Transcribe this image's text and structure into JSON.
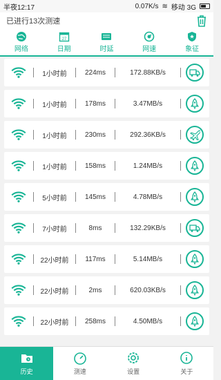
{
  "status": {
    "time": "半夜12:17",
    "speed": "0.07K/s",
    "carrier": "移动 3G"
  },
  "header": {
    "title": "已进行13次测速"
  },
  "tabs": [
    {
      "label": "网络",
      "icon": "globe-icon"
    },
    {
      "label": "日期",
      "icon": "calendar-icon"
    },
    {
      "label": "时延",
      "icon": "ping-icon"
    },
    {
      "label": "网速",
      "icon": "speedometer-icon"
    },
    {
      "label": "象征",
      "icon": "badge-icon"
    }
  ],
  "rows": [
    {
      "time": "1小时前",
      "ping": "224ms",
      "speed": "172.88KB/s",
      "icon": "truck-icon"
    },
    {
      "time": "1小时前",
      "ping": "178ms",
      "speed": "3.47MB/s",
      "icon": "rocket-icon"
    },
    {
      "time": "1小时前",
      "ping": "230ms",
      "speed": "292.36KB/s",
      "icon": "plane-icon"
    },
    {
      "time": "1小时前",
      "ping": "158ms",
      "speed": "1.24MB/s",
      "icon": "rocket-icon"
    },
    {
      "time": "5小时前",
      "ping": "145ms",
      "speed": "4.78MB/s",
      "icon": "rocket-icon"
    },
    {
      "time": "7小时前",
      "ping": "8ms",
      "speed": "132.29KB/s",
      "icon": "truck-icon"
    },
    {
      "time": "22小时前",
      "ping": "117ms",
      "speed": "5.14MB/s",
      "icon": "rocket-icon"
    },
    {
      "time": "22小时前",
      "ping": "2ms",
      "speed": "620.03KB/s",
      "icon": "rocket-icon"
    },
    {
      "time": "22小时前",
      "ping": "258ms",
      "speed": "4.50MB/s",
      "icon": "rocket-icon"
    }
  ],
  "bottom_nav": [
    {
      "label": "历史",
      "icon": "folder-icon",
      "active": true
    },
    {
      "label": "测速",
      "icon": "gauge-icon",
      "active": false
    },
    {
      "label": "设置",
      "icon": "settings-icon",
      "active": false
    },
    {
      "label": "关于",
      "icon": "info-icon",
      "active": false
    }
  ],
  "colors": {
    "accent": "#19b596"
  }
}
